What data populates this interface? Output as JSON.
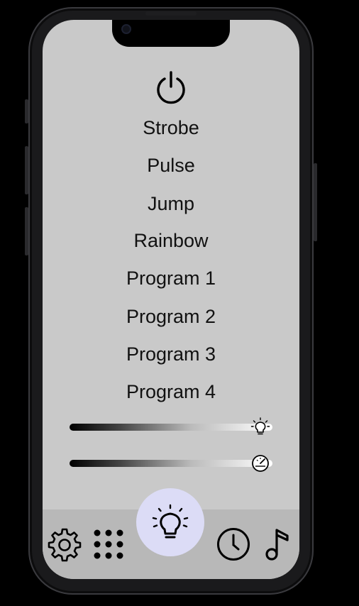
{
  "power": {
    "icon": "power-icon"
  },
  "modes": [
    {
      "label": "Strobe"
    },
    {
      "label": "Pulse"
    },
    {
      "label": "Jump"
    },
    {
      "label": "Rainbow"
    },
    {
      "label": "Program 1"
    },
    {
      "label": "Program 2"
    },
    {
      "label": "Program 3"
    },
    {
      "label": "Program 4"
    }
  ],
  "sliders": {
    "brightness": {
      "icon": "lightbulb-icon",
      "value": 0.94
    },
    "speed": {
      "icon": "speedometer-icon",
      "value": 0.94
    }
  },
  "nav": [
    {
      "icon": "gear-icon",
      "active": false
    },
    {
      "icon": "grid-icon",
      "active": false
    },
    {
      "icon": "lightbulb-icon",
      "active": true
    },
    {
      "icon": "clock-icon",
      "active": false
    },
    {
      "icon": "music-note-icon",
      "active": false
    }
  ],
  "colors": {
    "screen_bg": "#c9c9c9",
    "nav_bg": "#b8b8b8",
    "active_nav_bg": "#dcdcf6"
  }
}
